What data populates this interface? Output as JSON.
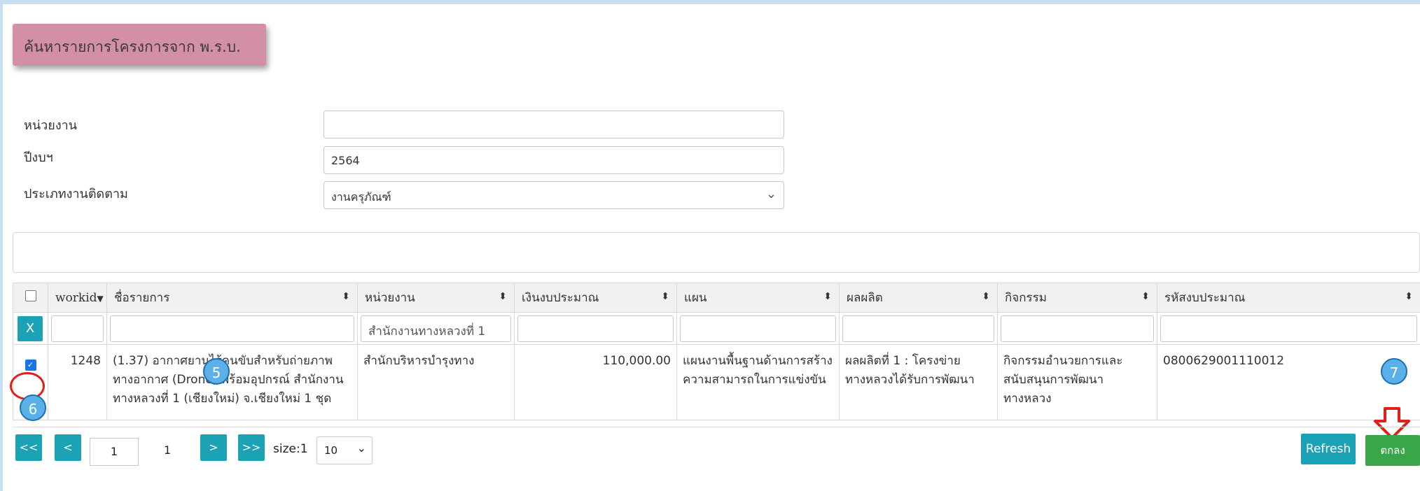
{
  "page_title": "ค้นหารายการโครงการจาก พ.ร.บ.",
  "form": {
    "agency_label": "หน่วยงาน",
    "agency_value": "",
    "fiscal_year_label": "ปีงบฯ",
    "fiscal_year_value": "2564",
    "tracking_type_label": "ประเภทงานติดตาม",
    "tracking_type_value": "งานครุภัณฑ์"
  },
  "table": {
    "headers": [
      "workid",
      "ชื่อรายการ",
      "หน่วยงาน",
      "เงินงบประมาณ",
      "แผน",
      "ผลผลิต",
      "กิจกรรม",
      "รหัสงบประมาณ"
    ],
    "filter_clear_label": "X",
    "filter_agency_value": "สำนักงานทางหลวงที่ 1",
    "rows": [
      {
        "checked": true,
        "workid": "1248",
        "name": "(1.37) อากาศยานไร้คนขับสำหรับถ่ายภาพทางอากาศ (Drone) พร้อมอุปกรณ์ สำนักงานทางหลวงที่ 1 (เชียงใหม่) จ.เชียงใหม่ 1 ชุด",
        "agency": "สำนักบริหารบำรุงทาง",
        "budget": "110,000.00",
        "plan": "แผนงานพื้นฐานด้านการสร้างความสามารถในการแข่งขัน",
        "output": "ผลผลิตที่ 1 : โครงข่ายทางหลวงได้รับการพัฒนา",
        "activity": "กิจกรรมอำนวยการและสนับสนุนการพัฒนาทางหลวง",
        "budget_code": "0800629001110012"
      }
    ]
  },
  "annotations": {
    "badge_5": "5",
    "badge_6": "6",
    "badge_7": "7"
  },
  "pager": {
    "first_label": "<<",
    "prev_label": "<",
    "page_value": "1",
    "total_pages": "1",
    "next_label": ">",
    "last_label": ">>",
    "size_label": "size:1",
    "page_size_value": "10"
  },
  "actions": {
    "refresh_label": "Refresh",
    "ok_label": "ตกลง"
  },
  "colors": {
    "title_bg": "#d48fa8",
    "teal": "#1ba3b5",
    "green": "#3aa64a",
    "highlight_red": "#e0201d",
    "badge_blue": "#5bb1e7"
  }
}
